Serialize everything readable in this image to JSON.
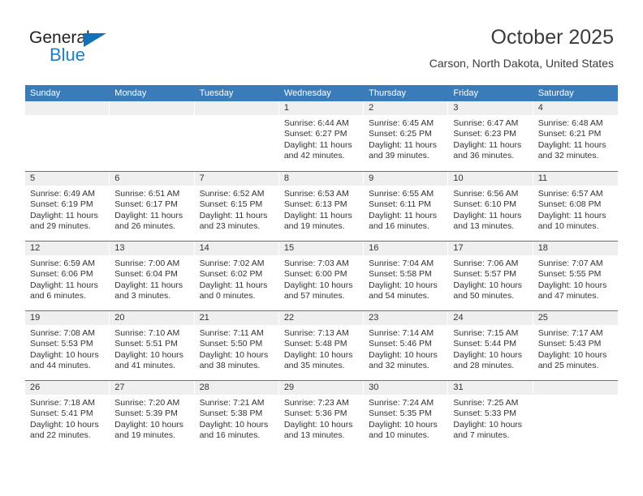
{
  "brand": {
    "name_part1": "General",
    "name_part2": "Blue",
    "triangle_icon": "triangle-icon",
    "colors": {
      "dark": "#231f20",
      "blue": "#1f7ec4"
    }
  },
  "header": {
    "title": "October 2025",
    "subtitle": "Carson, North Dakota, United States"
  },
  "theme": {
    "header_blue": "#3a7cb9",
    "day_band_gray": "#efefef",
    "text": "#333333"
  },
  "calendar": {
    "weekdays": [
      "Sunday",
      "Monday",
      "Tuesday",
      "Wednesday",
      "Thursday",
      "Friday",
      "Saturday"
    ],
    "weeks": [
      [
        {
          "day": "",
          "sunrise": "",
          "sunset": "",
          "daylight_line1": "",
          "daylight_line2": ""
        },
        {
          "day": "",
          "sunrise": "",
          "sunset": "",
          "daylight_line1": "",
          "daylight_line2": ""
        },
        {
          "day": "",
          "sunrise": "",
          "sunset": "",
          "daylight_line1": "",
          "daylight_line2": ""
        },
        {
          "day": "1",
          "sunrise": "Sunrise: 6:44 AM",
          "sunset": "Sunset: 6:27 PM",
          "daylight_line1": "Daylight: 11 hours",
          "daylight_line2": "and 42 minutes."
        },
        {
          "day": "2",
          "sunrise": "Sunrise: 6:45 AM",
          "sunset": "Sunset: 6:25 PM",
          "daylight_line1": "Daylight: 11 hours",
          "daylight_line2": "and 39 minutes."
        },
        {
          "day": "3",
          "sunrise": "Sunrise: 6:47 AM",
          "sunset": "Sunset: 6:23 PM",
          "daylight_line1": "Daylight: 11 hours",
          "daylight_line2": "and 36 minutes."
        },
        {
          "day": "4",
          "sunrise": "Sunrise: 6:48 AM",
          "sunset": "Sunset: 6:21 PM",
          "daylight_line1": "Daylight: 11 hours",
          "daylight_line2": "and 32 minutes."
        }
      ],
      [
        {
          "day": "5",
          "sunrise": "Sunrise: 6:49 AM",
          "sunset": "Sunset: 6:19 PM",
          "daylight_line1": "Daylight: 11 hours",
          "daylight_line2": "and 29 minutes."
        },
        {
          "day": "6",
          "sunrise": "Sunrise: 6:51 AM",
          "sunset": "Sunset: 6:17 PM",
          "daylight_line1": "Daylight: 11 hours",
          "daylight_line2": "and 26 minutes."
        },
        {
          "day": "7",
          "sunrise": "Sunrise: 6:52 AM",
          "sunset": "Sunset: 6:15 PM",
          "daylight_line1": "Daylight: 11 hours",
          "daylight_line2": "and 23 minutes."
        },
        {
          "day": "8",
          "sunrise": "Sunrise: 6:53 AM",
          "sunset": "Sunset: 6:13 PM",
          "daylight_line1": "Daylight: 11 hours",
          "daylight_line2": "and 19 minutes."
        },
        {
          "day": "9",
          "sunrise": "Sunrise: 6:55 AM",
          "sunset": "Sunset: 6:11 PM",
          "daylight_line1": "Daylight: 11 hours",
          "daylight_line2": "and 16 minutes."
        },
        {
          "day": "10",
          "sunrise": "Sunrise: 6:56 AM",
          "sunset": "Sunset: 6:10 PM",
          "daylight_line1": "Daylight: 11 hours",
          "daylight_line2": "and 13 minutes."
        },
        {
          "day": "11",
          "sunrise": "Sunrise: 6:57 AM",
          "sunset": "Sunset: 6:08 PM",
          "daylight_line1": "Daylight: 11 hours",
          "daylight_line2": "and 10 minutes."
        }
      ],
      [
        {
          "day": "12",
          "sunrise": "Sunrise: 6:59 AM",
          "sunset": "Sunset: 6:06 PM",
          "daylight_line1": "Daylight: 11 hours",
          "daylight_line2": "and 6 minutes."
        },
        {
          "day": "13",
          "sunrise": "Sunrise: 7:00 AM",
          "sunset": "Sunset: 6:04 PM",
          "daylight_line1": "Daylight: 11 hours",
          "daylight_line2": "and 3 minutes."
        },
        {
          "day": "14",
          "sunrise": "Sunrise: 7:02 AM",
          "sunset": "Sunset: 6:02 PM",
          "daylight_line1": "Daylight: 11 hours",
          "daylight_line2": "and 0 minutes."
        },
        {
          "day": "15",
          "sunrise": "Sunrise: 7:03 AM",
          "sunset": "Sunset: 6:00 PM",
          "daylight_line1": "Daylight: 10 hours",
          "daylight_line2": "and 57 minutes."
        },
        {
          "day": "16",
          "sunrise": "Sunrise: 7:04 AM",
          "sunset": "Sunset: 5:58 PM",
          "daylight_line1": "Daylight: 10 hours",
          "daylight_line2": "and 54 minutes."
        },
        {
          "day": "17",
          "sunrise": "Sunrise: 7:06 AM",
          "sunset": "Sunset: 5:57 PM",
          "daylight_line1": "Daylight: 10 hours",
          "daylight_line2": "and 50 minutes."
        },
        {
          "day": "18",
          "sunrise": "Sunrise: 7:07 AM",
          "sunset": "Sunset: 5:55 PM",
          "daylight_line1": "Daylight: 10 hours",
          "daylight_line2": "and 47 minutes."
        }
      ],
      [
        {
          "day": "19",
          "sunrise": "Sunrise: 7:08 AM",
          "sunset": "Sunset: 5:53 PM",
          "daylight_line1": "Daylight: 10 hours",
          "daylight_line2": "and 44 minutes."
        },
        {
          "day": "20",
          "sunrise": "Sunrise: 7:10 AM",
          "sunset": "Sunset: 5:51 PM",
          "daylight_line1": "Daylight: 10 hours",
          "daylight_line2": "and 41 minutes."
        },
        {
          "day": "21",
          "sunrise": "Sunrise: 7:11 AM",
          "sunset": "Sunset: 5:50 PM",
          "daylight_line1": "Daylight: 10 hours",
          "daylight_line2": "and 38 minutes."
        },
        {
          "day": "22",
          "sunrise": "Sunrise: 7:13 AM",
          "sunset": "Sunset: 5:48 PM",
          "daylight_line1": "Daylight: 10 hours",
          "daylight_line2": "and 35 minutes."
        },
        {
          "day": "23",
          "sunrise": "Sunrise: 7:14 AM",
          "sunset": "Sunset: 5:46 PM",
          "daylight_line1": "Daylight: 10 hours",
          "daylight_line2": "and 32 minutes."
        },
        {
          "day": "24",
          "sunrise": "Sunrise: 7:15 AM",
          "sunset": "Sunset: 5:44 PM",
          "daylight_line1": "Daylight: 10 hours",
          "daylight_line2": "and 28 minutes."
        },
        {
          "day": "25",
          "sunrise": "Sunrise: 7:17 AM",
          "sunset": "Sunset: 5:43 PM",
          "daylight_line1": "Daylight: 10 hours",
          "daylight_line2": "and 25 minutes."
        }
      ],
      [
        {
          "day": "26",
          "sunrise": "Sunrise: 7:18 AM",
          "sunset": "Sunset: 5:41 PM",
          "daylight_line1": "Daylight: 10 hours",
          "daylight_line2": "and 22 minutes."
        },
        {
          "day": "27",
          "sunrise": "Sunrise: 7:20 AM",
          "sunset": "Sunset: 5:39 PM",
          "daylight_line1": "Daylight: 10 hours",
          "daylight_line2": "and 19 minutes."
        },
        {
          "day": "28",
          "sunrise": "Sunrise: 7:21 AM",
          "sunset": "Sunset: 5:38 PM",
          "daylight_line1": "Daylight: 10 hours",
          "daylight_line2": "and 16 minutes."
        },
        {
          "day": "29",
          "sunrise": "Sunrise: 7:23 AM",
          "sunset": "Sunset: 5:36 PM",
          "daylight_line1": "Daylight: 10 hours",
          "daylight_line2": "and 13 minutes."
        },
        {
          "day": "30",
          "sunrise": "Sunrise: 7:24 AM",
          "sunset": "Sunset: 5:35 PM",
          "daylight_line1": "Daylight: 10 hours",
          "daylight_line2": "and 10 minutes."
        },
        {
          "day": "31",
          "sunrise": "Sunrise: 7:25 AM",
          "sunset": "Sunset: 5:33 PM",
          "daylight_line1": "Daylight: 10 hours",
          "daylight_line2": "and 7 minutes."
        },
        {
          "day": "",
          "sunrise": "",
          "sunset": "",
          "daylight_line1": "",
          "daylight_line2": ""
        }
      ]
    ]
  }
}
